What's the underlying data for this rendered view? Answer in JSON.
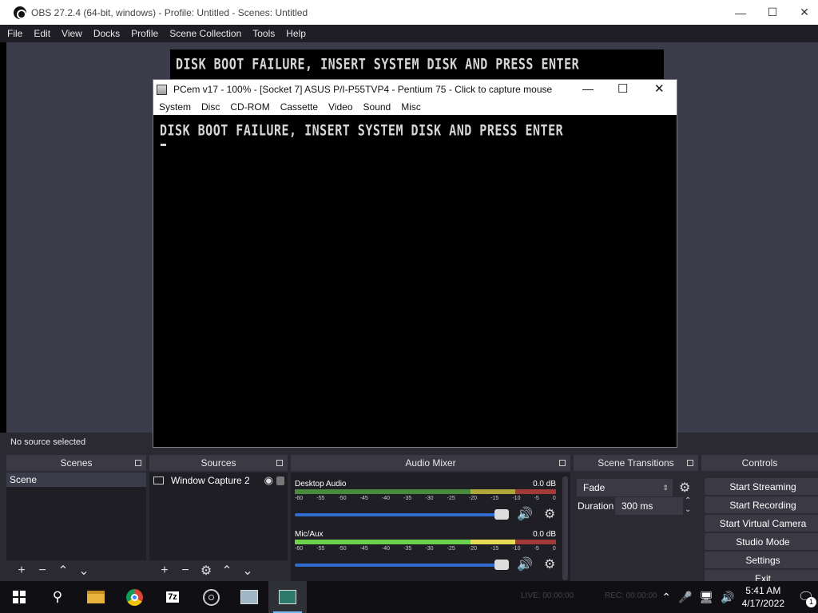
{
  "obs": {
    "title": "OBS 27.2.4 (64-bit, windows) - Profile: Untitled - Scenes: Untitled",
    "menu": [
      "File",
      "Edit",
      "View",
      "Docks",
      "Profile",
      "Scene Collection",
      "Tools",
      "Help"
    ],
    "preview_text": "DISK BOOT FAILURE, INSERT SYSTEM DISK AND PRESS ENTER",
    "status": "No source selected",
    "docks": {
      "scenes": {
        "title": "Scenes",
        "items": [
          "Scene"
        ]
      },
      "sources": {
        "title": "Sources",
        "items": [
          "Window Capture 2"
        ]
      },
      "mixer": {
        "title": "Audio Mixer",
        "channels": [
          {
            "name": "Desktop Audio",
            "db": "0.0 dB"
          },
          {
            "name": "Mic/Aux",
            "db": "0.0 dB"
          }
        ],
        "scale": [
          "-60",
          "-55",
          "-50",
          "-45",
          "-40",
          "-35",
          "-30",
          "-25",
          "-20",
          "-15",
          "-10",
          "-5",
          "0"
        ]
      },
      "transitions": {
        "title": "Scene Transitions",
        "transition": "Fade",
        "duration_label": "Duration",
        "duration_value": "300 ms"
      },
      "controls": {
        "title": "Controls",
        "buttons": [
          "Start Streaming",
          "Start Recording",
          "Start Virtual Camera",
          "Studio Mode",
          "Settings",
          "Exit"
        ]
      }
    }
  },
  "pcem": {
    "title": "PCem v17 - 100% - [Socket 7] ASUS P/I-P55TVP4 - Pentium 75 - Click to capture mouse",
    "menu": [
      "System",
      "Disc",
      "CD-ROM",
      "Cassette",
      "Video",
      "Sound",
      "Misc"
    ],
    "screen_text": "DISK BOOT FAILURE, INSERT SYSTEM DISK AND PRESS ENTER"
  },
  "taskbar": {
    "apps": [
      "start",
      "search",
      "file-explorer",
      "chrome",
      "7zip",
      "obs",
      "app",
      "pcem"
    ],
    "seven_zip_label": "7z",
    "status_text_live": "LIVE: 00:00:00",
    "status_text_rec": "REC: 00:00:00",
    "time": "5:41 AM",
    "date": "4/17/2022",
    "notification_count": "1"
  }
}
